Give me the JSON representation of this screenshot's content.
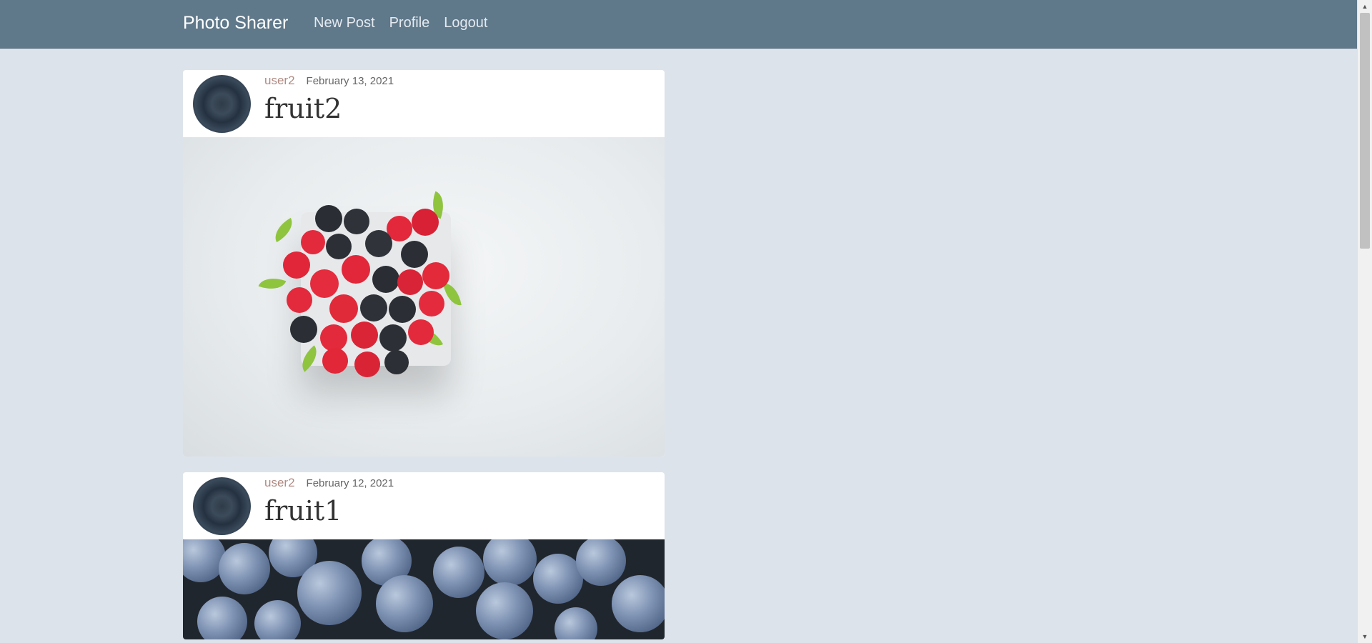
{
  "navbar": {
    "brand": "Photo Sharer",
    "links": [
      "New Post",
      "Profile",
      "Logout"
    ],
    "background": "#5f788a"
  },
  "posts": [
    {
      "author": "user2",
      "date": "February 13, 2021",
      "title": "fruit2",
      "image": "raspberries-blackberries-photo"
    },
    {
      "author": "user2",
      "date": "February 12, 2021",
      "title": "fruit1",
      "image": "blueberries-photo"
    }
  ],
  "colors": {
    "page_background": "#dce3ea",
    "author_link": "#b08b84"
  }
}
